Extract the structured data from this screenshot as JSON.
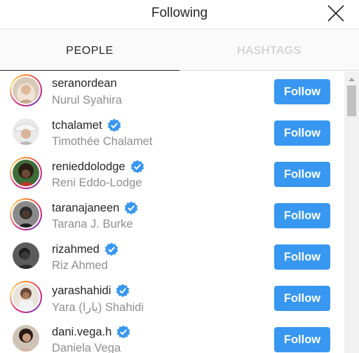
{
  "dialog": {
    "title": "Following"
  },
  "tabs": [
    {
      "label": "PEOPLE",
      "active": true
    },
    {
      "label": "HASHTAGS",
      "active": false
    }
  ],
  "colors": {
    "follow_blue": "#3897f0",
    "verified_blue": "#3897f0",
    "secondary_text": "#8e8e8e"
  },
  "users": [
    {
      "username": "seranordean",
      "full_name": "Nurul Syahira",
      "verified": false,
      "story_ring": true,
      "button": "Follow"
    },
    {
      "username": "tchalamet",
      "full_name": "Timothée Chalamet",
      "verified": true,
      "story_ring": false,
      "button": "Follow"
    },
    {
      "username": "renieddolodge",
      "full_name": "Reni Eddo-Lodge",
      "verified": true,
      "story_ring": true,
      "button": "Follow"
    },
    {
      "username": "taranajaneen",
      "full_name": "Tarana J. Burke",
      "verified": true,
      "story_ring": true,
      "button": "Follow"
    },
    {
      "username": "rizahmed",
      "full_name": "Riz Ahmed",
      "verified": true,
      "story_ring": false,
      "button": "Follow"
    },
    {
      "username": "yarashahidi",
      "full_name": "Yara (يارا) Shahidi",
      "verified": true,
      "story_ring": true,
      "button": "Follow"
    },
    {
      "username": "dani.vega.h",
      "full_name": "Daniela Vega",
      "verified": true,
      "story_ring": false,
      "button": "Follow"
    }
  ]
}
